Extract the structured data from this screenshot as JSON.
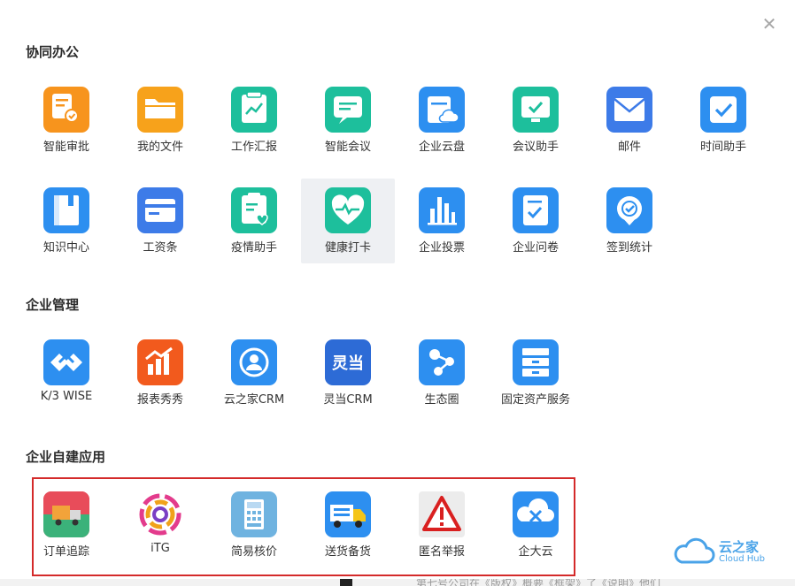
{
  "close": {
    "glyph": "✕"
  },
  "sections": {
    "collab": "协同办公",
    "mgmt": "企业管理",
    "custom": "企业自建应用"
  },
  "collab_apps": [
    {
      "label": "智能审批",
      "icon": "approval-icon",
      "color": "#f7941d"
    },
    {
      "label": "我的文件",
      "icon": "folder-icon",
      "color": "#f7a21b"
    },
    {
      "label": "工作汇报",
      "icon": "report-icon",
      "color": "#1dbf9c"
    },
    {
      "label": "智能会议",
      "icon": "meeting-icon",
      "color": "#1dbf9c"
    },
    {
      "label": "企业云盘",
      "icon": "cloud-disk-icon",
      "color": "#2d8ff0"
    },
    {
      "label": "会议助手",
      "icon": "meeting-assistant-icon",
      "color": "#1dbf9c"
    },
    {
      "label": "邮件",
      "icon": "mail-icon",
      "color": "#3d7be8"
    },
    {
      "label": "时间助手",
      "icon": "calendar-check-icon",
      "color": "#2d8ff0"
    },
    {
      "label": "知识中心",
      "icon": "knowledge-icon",
      "color": "#2d8ff0"
    },
    {
      "label": "工资条",
      "icon": "payslip-icon",
      "color": "#3d7be8"
    },
    {
      "label": "疫情助手",
      "icon": "epidemic-icon",
      "color": "#1dbf9c"
    },
    {
      "label": "健康打卡",
      "icon": "health-checkin-icon",
      "color": "#1dbf9c"
    },
    {
      "label": "企业投票",
      "icon": "vote-icon",
      "color": "#2d8ff0"
    },
    {
      "label": "企业问卷",
      "icon": "survey-icon",
      "color": "#2d8ff0"
    },
    {
      "label": "签到统计",
      "icon": "checkin-stats-icon",
      "color": "#2d8ff0"
    }
  ],
  "mgmt_apps": [
    {
      "label": "K/3 WISE",
      "icon": "k3-wise-icon",
      "color": "#2d8ff0"
    },
    {
      "label": "报表秀秀",
      "icon": "report-show-icon",
      "color": "#f25a1d"
    },
    {
      "label": "云之家CRM",
      "icon": "crm-icon",
      "color": "#2d8ff0"
    },
    {
      "label": "灵当CRM",
      "icon": "lingdang-crm-icon",
      "color": "#2d6bd6",
      "icon_text": "灵当"
    },
    {
      "label": "生态圈",
      "icon": "ecosystem-icon",
      "color": "#2d8ff0"
    },
    {
      "label": "固定资产服务",
      "icon": "fixed-assets-icon",
      "color": "#2d8ff0"
    }
  ],
  "custom_apps": [
    {
      "label": "订单追踪",
      "icon": "order-tracking-icon",
      "color": "#e84c5a"
    },
    {
      "label": "iTG",
      "icon": "itg-logo-icon",
      "color": "#ffffff"
    },
    {
      "label": "简易核价",
      "icon": "calculator-icon",
      "color": "#6fb3e0"
    },
    {
      "label": "送货备货",
      "icon": "delivery-truck-icon",
      "color": "#2d8ff0"
    },
    {
      "label": "匿名举报",
      "icon": "warning-icon",
      "color": "#ececec"
    },
    {
      "label": "企大云",
      "icon": "qidayun-icon",
      "color": "#2d8ff0"
    }
  ],
  "watermark": {
    "title": "云之家",
    "subtitle": "Cloud Hub"
  },
  "bottom_text": "第七号公司在《版权》概要《框架》了《说明》他们"
}
